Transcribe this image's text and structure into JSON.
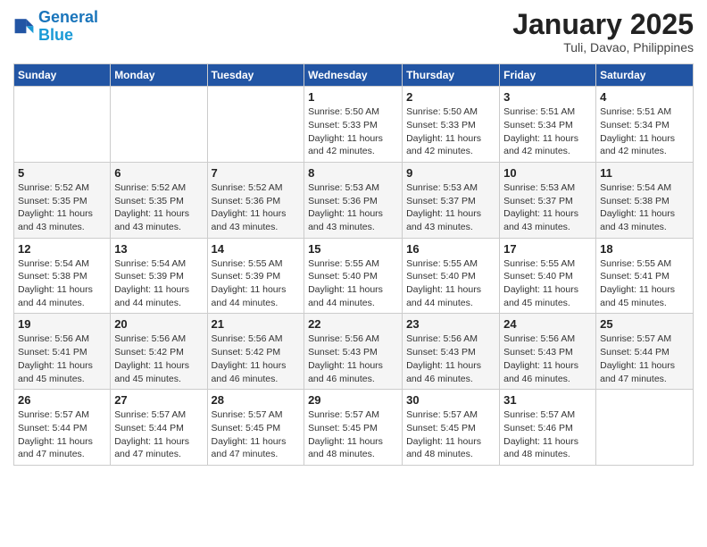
{
  "header": {
    "logo_line1": "General",
    "logo_line2": "Blue",
    "title": "January 2025",
    "subtitle": "Tuli, Davao, Philippines"
  },
  "weekdays": [
    "Sunday",
    "Monday",
    "Tuesday",
    "Wednesday",
    "Thursday",
    "Friday",
    "Saturday"
  ],
  "weeks": [
    [
      {
        "day": "",
        "info": ""
      },
      {
        "day": "",
        "info": ""
      },
      {
        "day": "",
        "info": ""
      },
      {
        "day": "1",
        "info": "Sunrise: 5:50 AM\nSunset: 5:33 PM\nDaylight: 11 hours\nand 42 minutes."
      },
      {
        "day": "2",
        "info": "Sunrise: 5:50 AM\nSunset: 5:33 PM\nDaylight: 11 hours\nand 42 minutes."
      },
      {
        "day": "3",
        "info": "Sunrise: 5:51 AM\nSunset: 5:34 PM\nDaylight: 11 hours\nand 42 minutes."
      },
      {
        "day": "4",
        "info": "Sunrise: 5:51 AM\nSunset: 5:34 PM\nDaylight: 11 hours\nand 42 minutes."
      }
    ],
    [
      {
        "day": "5",
        "info": "Sunrise: 5:52 AM\nSunset: 5:35 PM\nDaylight: 11 hours\nand 43 minutes."
      },
      {
        "day": "6",
        "info": "Sunrise: 5:52 AM\nSunset: 5:35 PM\nDaylight: 11 hours\nand 43 minutes."
      },
      {
        "day": "7",
        "info": "Sunrise: 5:52 AM\nSunset: 5:36 PM\nDaylight: 11 hours\nand 43 minutes."
      },
      {
        "day": "8",
        "info": "Sunrise: 5:53 AM\nSunset: 5:36 PM\nDaylight: 11 hours\nand 43 minutes."
      },
      {
        "day": "9",
        "info": "Sunrise: 5:53 AM\nSunset: 5:37 PM\nDaylight: 11 hours\nand 43 minutes."
      },
      {
        "day": "10",
        "info": "Sunrise: 5:53 AM\nSunset: 5:37 PM\nDaylight: 11 hours\nand 43 minutes."
      },
      {
        "day": "11",
        "info": "Sunrise: 5:54 AM\nSunset: 5:38 PM\nDaylight: 11 hours\nand 43 minutes."
      }
    ],
    [
      {
        "day": "12",
        "info": "Sunrise: 5:54 AM\nSunset: 5:38 PM\nDaylight: 11 hours\nand 44 minutes."
      },
      {
        "day": "13",
        "info": "Sunrise: 5:54 AM\nSunset: 5:39 PM\nDaylight: 11 hours\nand 44 minutes."
      },
      {
        "day": "14",
        "info": "Sunrise: 5:55 AM\nSunset: 5:39 PM\nDaylight: 11 hours\nand 44 minutes."
      },
      {
        "day": "15",
        "info": "Sunrise: 5:55 AM\nSunset: 5:40 PM\nDaylight: 11 hours\nand 44 minutes."
      },
      {
        "day": "16",
        "info": "Sunrise: 5:55 AM\nSunset: 5:40 PM\nDaylight: 11 hours\nand 44 minutes."
      },
      {
        "day": "17",
        "info": "Sunrise: 5:55 AM\nSunset: 5:40 PM\nDaylight: 11 hours\nand 45 minutes."
      },
      {
        "day": "18",
        "info": "Sunrise: 5:55 AM\nSunset: 5:41 PM\nDaylight: 11 hours\nand 45 minutes."
      }
    ],
    [
      {
        "day": "19",
        "info": "Sunrise: 5:56 AM\nSunset: 5:41 PM\nDaylight: 11 hours\nand 45 minutes."
      },
      {
        "day": "20",
        "info": "Sunrise: 5:56 AM\nSunset: 5:42 PM\nDaylight: 11 hours\nand 45 minutes."
      },
      {
        "day": "21",
        "info": "Sunrise: 5:56 AM\nSunset: 5:42 PM\nDaylight: 11 hours\nand 46 minutes."
      },
      {
        "day": "22",
        "info": "Sunrise: 5:56 AM\nSunset: 5:43 PM\nDaylight: 11 hours\nand 46 minutes."
      },
      {
        "day": "23",
        "info": "Sunrise: 5:56 AM\nSunset: 5:43 PM\nDaylight: 11 hours\nand 46 minutes."
      },
      {
        "day": "24",
        "info": "Sunrise: 5:56 AM\nSunset: 5:43 PM\nDaylight: 11 hours\nand 46 minutes."
      },
      {
        "day": "25",
        "info": "Sunrise: 5:57 AM\nSunset: 5:44 PM\nDaylight: 11 hours\nand 47 minutes."
      }
    ],
    [
      {
        "day": "26",
        "info": "Sunrise: 5:57 AM\nSunset: 5:44 PM\nDaylight: 11 hours\nand 47 minutes."
      },
      {
        "day": "27",
        "info": "Sunrise: 5:57 AM\nSunset: 5:44 PM\nDaylight: 11 hours\nand 47 minutes."
      },
      {
        "day": "28",
        "info": "Sunrise: 5:57 AM\nSunset: 5:45 PM\nDaylight: 11 hours\nand 47 minutes."
      },
      {
        "day": "29",
        "info": "Sunrise: 5:57 AM\nSunset: 5:45 PM\nDaylight: 11 hours\nand 48 minutes."
      },
      {
        "day": "30",
        "info": "Sunrise: 5:57 AM\nSunset: 5:45 PM\nDaylight: 11 hours\nand 48 minutes."
      },
      {
        "day": "31",
        "info": "Sunrise: 5:57 AM\nSunset: 5:46 PM\nDaylight: 11 hours\nand 48 minutes."
      },
      {
        "day": "",
        "info": ""
      }
    ]
  ]
}
